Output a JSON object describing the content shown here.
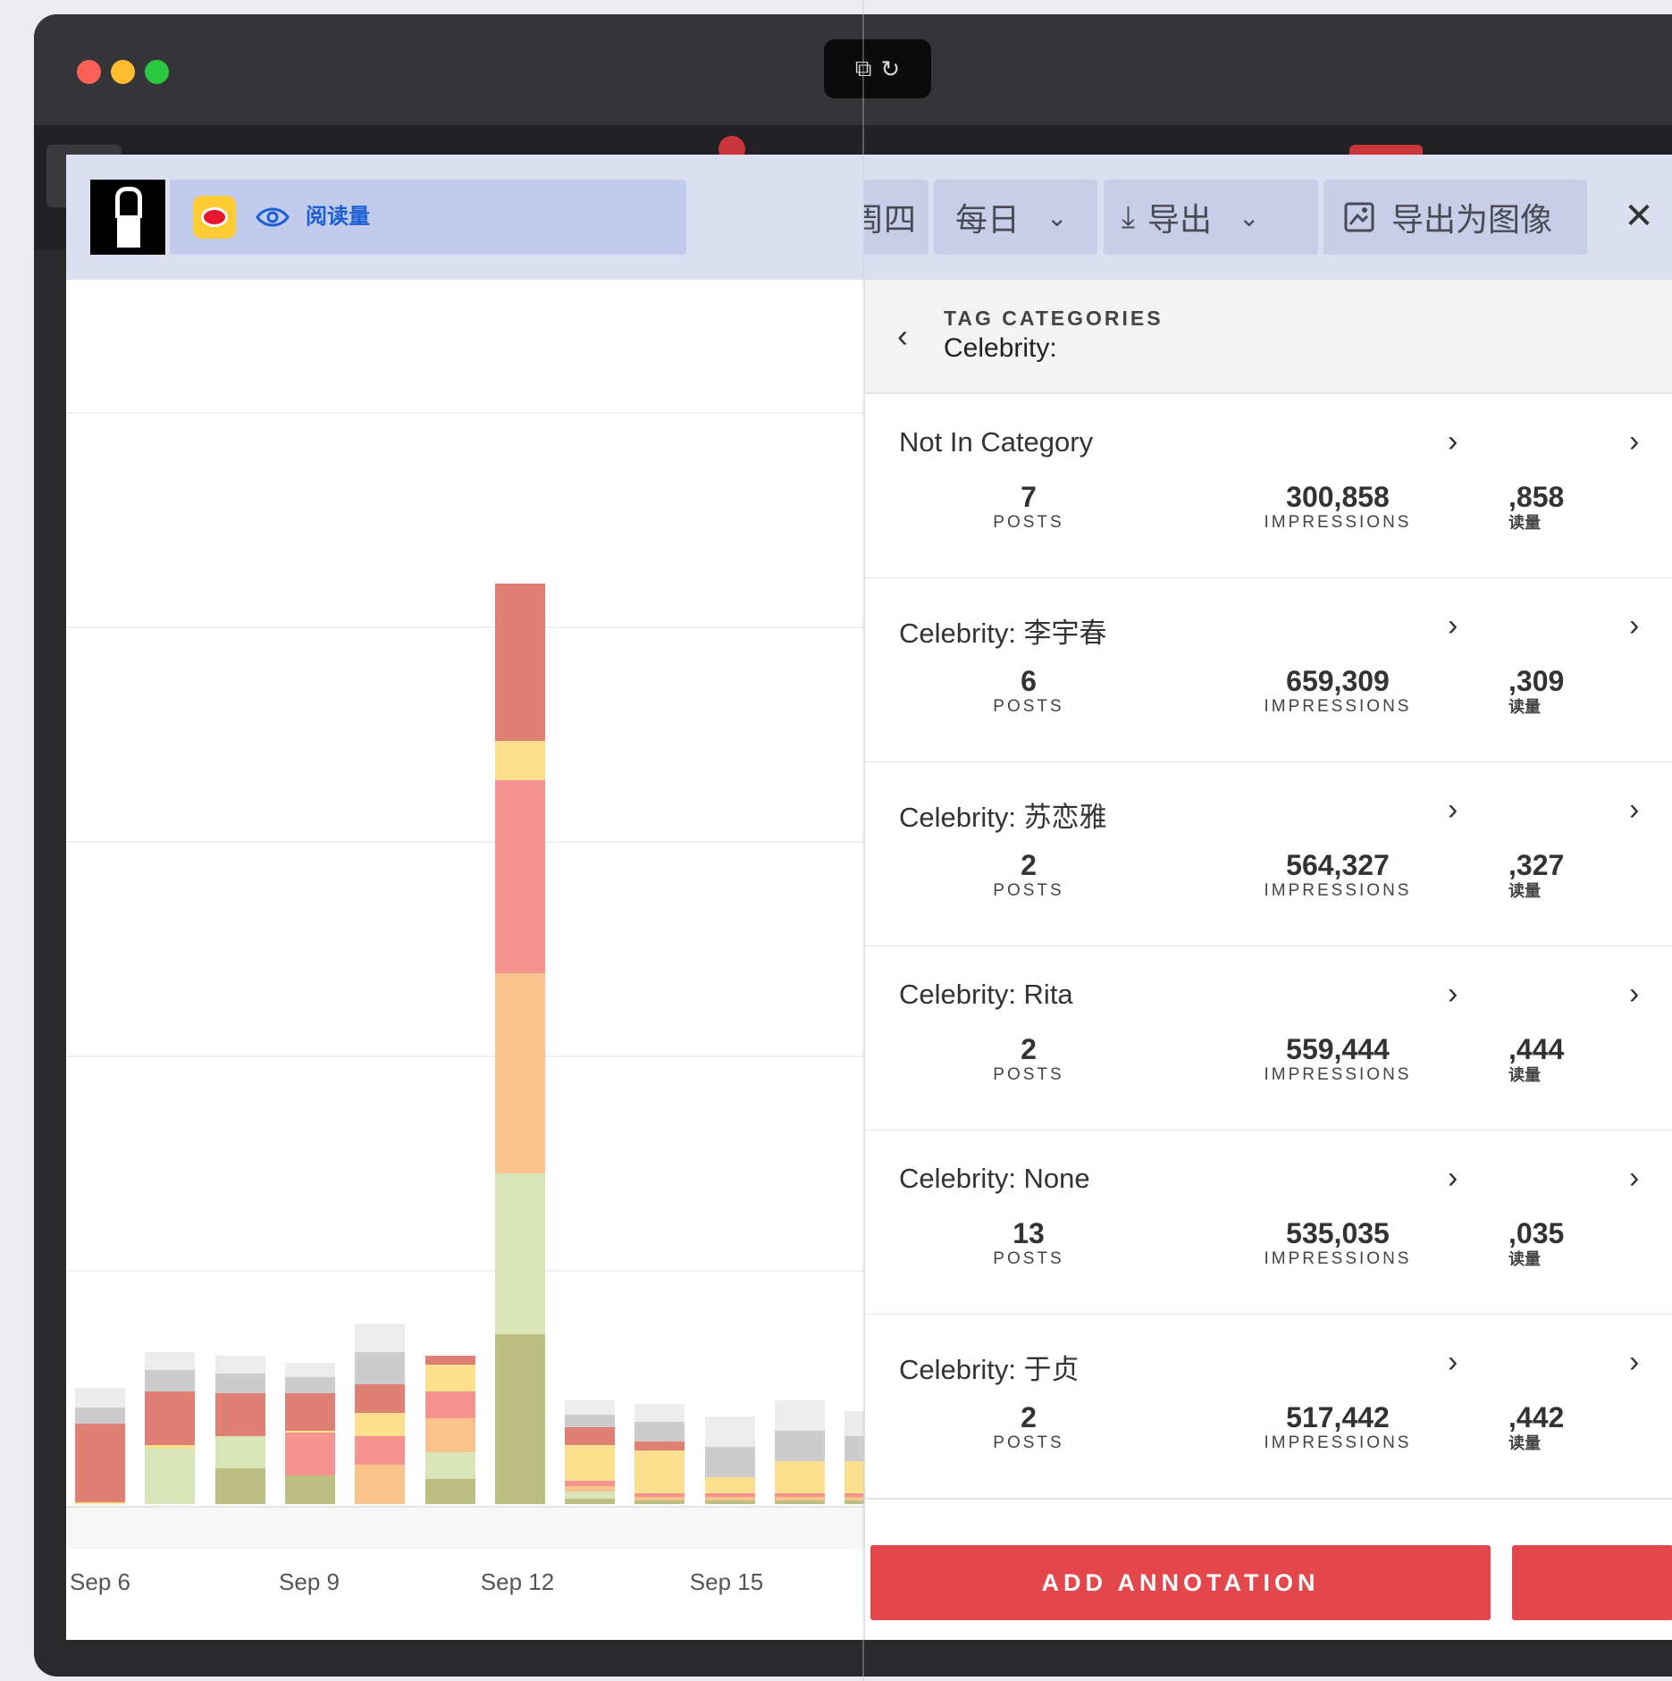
{
  "browser": {
    "traffic_lights": [
      "#fe5f57",
      "#febc2e",
      "#28c840"
    ],
    "toolbar_icons": [
      "share-icon",
      "reload-icon"
    ]
  },
  "header": {
    "metric_label": "阅读量",
    "buttons": [
      {
        "label": "周四",
        "name": "day-of-week-button"
      },
      {
        "label": "每日",
        "name": "interval-dropdown"
      },
      {
        "label": "导出",
        "name": "export-dropdown"
      },
      {
        "label": "导出为图像",
        "name": "export-image-button"
      }
    ]
  },
  "chart_data": {
    "type": "bar",
    "stacked": true,
    "x_ticks": [
      "Sep 6",
      "Sep 9",
      "Sep 12",
      "Sep 15"
    ],
    "colors": [
      "#bdbe82",
      "#d9e4b8",
      "#f9c48b",
      "#f59391",
      "#fde08e",
      "#e07f73",
      "#cccccc",
      "#ececec"
    ],
    "bars": [
      [
        0,
        0,
        0,
        0,
        2,
        88,
        18,
        22
      ],
      [
        0,
        62,
        0,
        0,
        4,
        60,
        24,
        20
      ],
      [
        40,
        36,
        0,
        0,
        0,
        48,
        22,
        20
      ],
      [
        32,
        0,
        0,
        48,
        2,
        42,
        18,
        16
      ],
      [
        0,
        0,
        44,
        32,
        26,
        32,
        36,
        32
      ],
      [
        28,
        30,
        38,
        30,
        30,
        10,
        0,
        0
      ],
      [
        190,
        180,
        224,
        216,
        44,
        176,
        0,
        0
      ],
      [
        6,
        8,
        6,
        6,
        40,
        20,
        14,
        16
      ],
      [
        4,
        0,
        4,
        4,
        48,
        10,
        22,
        20
      ],
      [
        4,
        0,
        4,
        4,
        18,
        0,
        34,
        34
      ],
      [
        4,
        0,
        4,
        4,
        36,
        0,
        34,
        34
      ],
      [
        4,
        0,
        4,
        4,
        36,
        0,
        28,
        28
      ]
    ]
  },
  "panel": {
    "kicker": "TAG CATEGORIES",
    "title": "Celebrity:",
    "rows": [
      {
        "name": "Not In Category",
        "posts": "7",
        "posts_label": "POSTS",
        "impressions": "300,858",
        "impressions_label": "IMPRESSIONS",
        "reads": ",858",
        "reads_label": "读量"
      },
      {
        "name": "Celebrity: 李宇春",
        "posts": "6",
        "posts_label": "POSTS",
        "impressions": "659,309",
        "impressions_label": "IMPRESSIONS",
        "reads": ",309",
        "reads_label": "读量"
      },
      {
        "name": "Celebrity: 苏恋雅",
        "posts": "2",
        "posts_label": "POSTS",
        "impressions": "564,327",
        "impressions_label": "IMPRESSIONS",
        "reads": ",327",
        "reads_label": "读量"
      },
      {
        "name": "Celebrity: Rita",
        "posts": "2",
        "posts_label": "POSTS",
        "impressions": "559,444",
        "impressions_label": "IMPRESSIONS",
        "reads": ",444",
        "reads_label": "读量"
      },
      {
        "name": "Celebrity: None",
        "posts": "13",
        "posts_label": "POSTS",
        "impressions": "535,035",
        "impressions_label": "IMPRESSIONS",
        "reads": ",035",
        "reads_label": "读量"
      },
      {
        "name": "Celebrity: 于贞",
        "posts": "2",
        "posts_label": "POSTS",
        "impressions": "517,442",
        "impressions_label": "IMPRESSIONS",
        "reads": ",442",
        "reads_label": "读量"
      }
    ],
    "add_annotation_label": "ADD ANNOTATION"
  }
}
